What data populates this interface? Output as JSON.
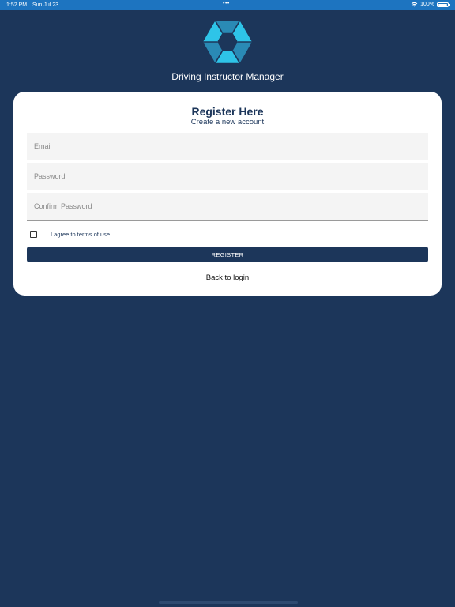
{
  "status_bar": {
    "time": "1:52 PM",
    "date": "Sun Jul 23",
    "dots": "•••",
    "battery": "100%",
    "wifi_icon": "wifi-icon",
    "battery_icon": "battery-icon",
    "background": "#1d74c0"
  },
  "app": {
    "title": "Driving Instructor Manager",
    "logo_icon": "hexagon-logo-icon",
    "background": "#1c365a"
  },
  "form": {
    "title": "Register Here",
    "subtitle": "Create a new account",
    "email": {
      "value": "",
      "placeholder": "Email"
    },
    "password": {
      "value": "",
      "placeholder": "Password"
    },
    "confirm_password": {
      "value": "",
      "placeholder": "Confirm Password"
    },
    "terms": {
      "label": "I agree to terms of use",
      "checked": false
    },
    "register_label": "REGISTER",
    "back_label": "Back to login"
  },
  "colors": {
    "accent": "#1c365a",
    "logo_light": "#2ec4e8",
    "logo_dark": "#2a8ab5"
  }
}
